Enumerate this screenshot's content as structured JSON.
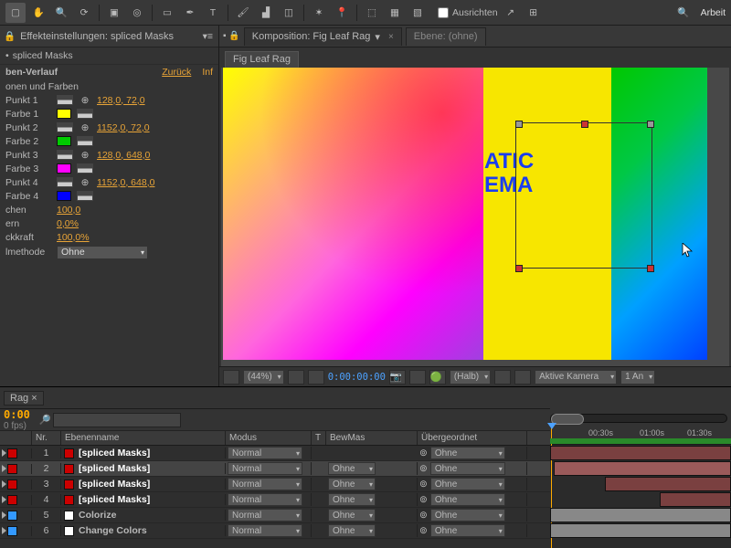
{
  "toolbar": {
    "align": "Ausrichten",
    "work": "Arbeit"
  },
  "panel": {
    "title": "Effekteinstellungen: spliced Masks",
    "layer": "spliced Masks",
    "effect": "ben-Verlauf",
    "reset": "Zurück",
    "info": "Inf",
    "section": "onen und Farben",
    "rows": [
      {
        "lbl": "Punkt 1",
        "val": "128,0, 72,0",
        "type": "pt"
      },
      {
        "lbl": "Farbe 1",
        "color": "#ffff00",
        "type": "cl"
      },
      {
        "lbl": "Punkt 2",
        "val": "1152,0, 72,0",
        "type": "pt"
      },
      {
        "lbl": "Farbe 2",
        "color": "#00cc00",
        "type": "cl"
      },
      {
        "lbl": "Punkt 3",
        "val": "128,0, 648,0",
        "type": "pt"
      },
      {
        "lbl": "Farbe 3",
        "color": "#ff00ff",
        "type": "cl"
      },
      {
        "lbl": "Punkt 4",
        "val": "1152,0, 648,0",
        "type": "pt"
      },
      {
        "lbl": "Farbe 4",
        "color": "#0000ff",
        "type": "cl"
      }
    ],
    "extras": [
      {
        "lbl": "chen",
        "val": "100,0"
      },
      {
        "lbl": "ern",
        "val": "0,0%"
      },
      {
        "lbl": "ckkraft",
        "val": "100,0%"
      }
    ],
    "blend_lbl": "lmethode",
    "blend_val": "Ohne"
  },
  "comp": {
    "tab1": "Komposition: Fig Leaf Rag",
    "tab2": "Ebene: (ohne)",
    "sub": "Fig Leaf Rag",
    "txt1": "ATIC",
    "txt2": "EMA"
  },
  "viewer_foot": {
    "zoom": "(44%)",
    "tc": "0:00:00:00",
    "res": "(Halb)",
    "cam": "Aktive Kamera",
    "views": "1 An"
  },
  "timeline": {
    "tab": "Rag",
    "time": "0:00",
    "fps": "0 fps)",
    "cols": {
      "nr": "Nr.",
      "name": "Ebenenname",
      "mode": "Modus",
      "t": "T",
      "mask": "BewMas",
      "parent": "Übergeordnet"
    },
    "none": "Ohne",
    "normal": "Normal",
    "layers": [
      {
        "n": "1",
        "c": "#cc0000",
        "name": "[spliced Masks]",
        "sel": false,
        "br": true,
        "sw": "#cc0000"
      },
      {
        "n": "2",
        "c": "#cc0000",
        "name": "[spliced Masks]",
        "sel": true,
        "br": true,
        "sw": "#cc0000"
      },
      {
        "n": "3",
        "c": "#cc0000",
        "name": "[spliced Masks]",
        "sel": false,
        "br": true,
        "sw": "#cc0000"
      },
      {
        "n": "4",
        "c": "#cc0000",
        "name": "[spliced Masks]",
        "sel": false,
        "br": true,
        "sw": "#cc0000"
      },
      {
        "n": "5",
        "c": "#3399ff",
        "name": "Colorize",
        "sel": false,
        "br": false,
        "sw": "#ffffff"
      },
      {
        "n": "6",
        "c": "#3399ff",
        "name": "Change Colors",
        "sel": false,
        "br": false,
        "sw": "#ffffff"
      }
    ],
    "ruler": [
      "00:30s",
      "01:00s",
      "01:30s"
    ]
  }
}
